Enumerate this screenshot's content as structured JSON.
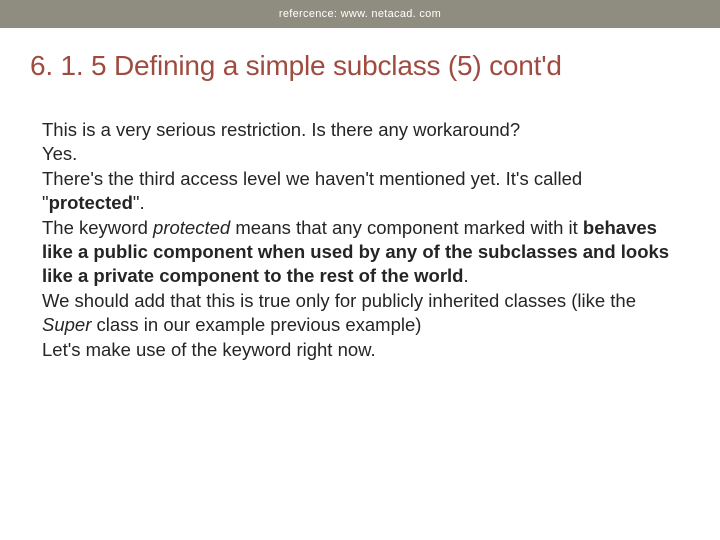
{
  "header": {
    "reference": "refercence: www. netacad. com"
  },
  "slide": {
    "title": "6. 1. 5 Defining a simple subclass (5) cont'd"
  },
  "content": {
    "p1_a": "This is a very serious restriction. Is there any workaround?",
    "p2_a": "Yes.",
    "p3_a": "There's the third access level we haven't mentioned yet. It's called \"",
    "p3_b": "protected",
    "p3_c": "\".",
    "p4_a": "The keyword ",
    "p4_b": "protected",
    "p4_c": " means that any component marked with it ",
    "p4_d": "behaves like a public component when used by any of the subclasses and looks like a private component to the rest of the world",
    "p4_e": ".",
    "p5_a": "We should add that this is true only for publicly inherited classes (like the ",
    "p5_b": "Super",
    "p5_c": " class in our example previous example)",
    "p6_a": "Let's make use of the keyword right now."
  }
}
